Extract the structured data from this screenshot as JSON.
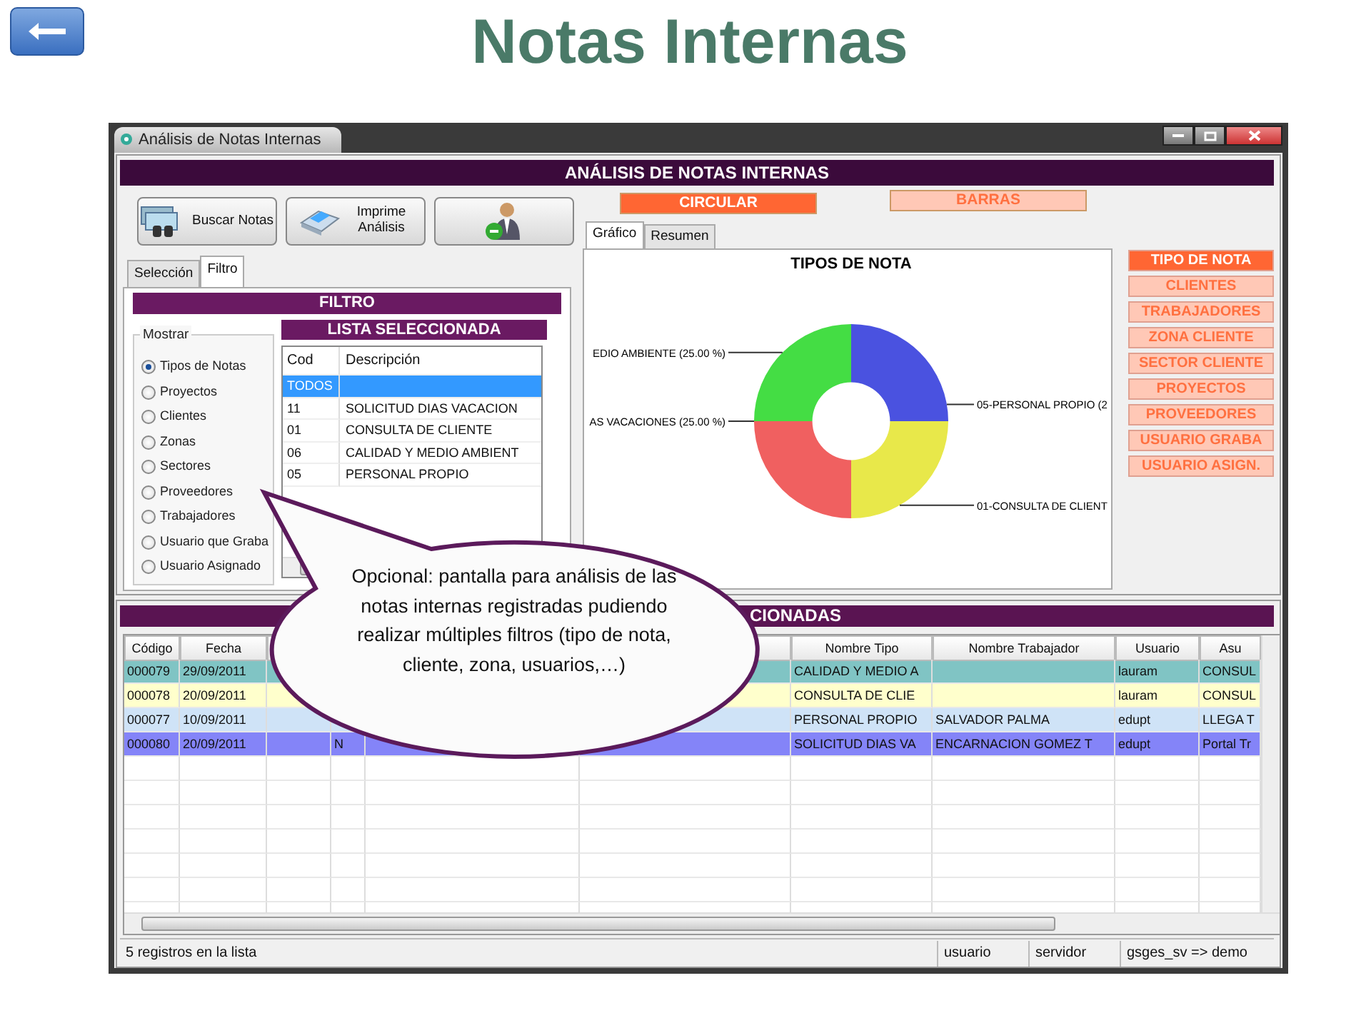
{
  "slide": {
    "title": "Notas Internas"
  },
  "window": {
    "title": "Análisis de Notas Internas",
    "header": "ANÁLISIS DE NOTAS INTERNAS"
  },
  "toolbar": [
    {
      "kind": "search",
      "label": "Buscar Notas"
    },
    {
      "kind": "print",
      "label": "Imprime Análisis"
    },
    {
      "kind": "user"
    }
  ],
  "left_tabs": [
    {
      "label": "Selección",
      "selected": false
    },
    {
      "label": "Filtro",
      "selected": true
    }
  ],
  "filter": {
    "title": "FILTRO",
    "group_label": "Mostrar",
    "list_title": "LISTA SELECCIONADA",
    "options": [
      {
        "label": "Tipos de Notas",
        "selected": true
      },
      {
        "label": "Proyectos",
        "selected": false
      },
      {
        "label": "Clientes",
        "selected": false
      },
      {
        "label": "Zonas",
        "selected": false
      },
      {
        "label": "Sectores",
        "selected": false
      },
      {
        "label": "Proveedores",
        "selected": false
      },
      {
        "label": "Trabajadores",
        "selected": false
      },
      {
        "label": "Usuario que Graba",
        "selected": false
      },
      {
        "label": "Usuario Asignado",
        "selected": false
      }
    ],
    "list_columns": [
      "Cod",
      "Descripción"
    ],
    "list_rows": [
      {
        "cells": [
          "TODOS"
        ],
        "selected": true
      },
      {
        "cells": [
          "11",
          "SOLICITUD DIAS VACACION"
        ],
        "selected": false
      },
      {
        "cells": [
          "01",
          "CONSULTA DE CLIENTE"
        ],
        "selected": false
      },
      {
        "cells": [
          "06",
          "CALIDAD Y MEDIO AMBIENT"
        ],
        "selected": false
      },
      {
        "cells": [
          "05",
          "PERSONAL PROPIO"
        ],
        "selected": false
      }
    ]
  },
  "chart_types": [
    {
      "label": "CIRCULAR",
      "selected": true
    },
    {
      "label": "BARRAS",
      "selected": false
    }
  ],
  "chart_tabs": [
    {
      "label": "Gráfico",
      "selected": true
    },
    {
      "label": "Resumen",
      "selected": false
    }
  ],
  "chart": {
    "chart_data": {
      "type": "donut",
      "title": "TIPOS DE NOTA",
      "categories": [
        "05-PERSONAL PROPIO (2",
        "01-CONSULTA DE CLIENT",
        "AS VACACIONES (25.00 %)",
        "EDIO AMBIENTE (25.00 %)"
      ],
      "values": [
        25,
        25,
        25,
        25
      ]
    }
  },
  "groupings": [
    {
      "label": "TIPO DE NOTA",
      "selected": true
    },
    {
      "label": "CLIENTES",
      "selected": false
    },
    {
      "label": "TRABAJADORES",
      "selected": false
    },
    {
      "label": "ZONA CLIENTE",
      "selected": false
    },
    {
      "label": "SECTOR CLIENTE",
      "selected": false
    },
    {
      "label": "PROYECTOS",
      "selected": false
    },
    {
      "label": "PROVEEDORES",
      "selected": false
    },
    {
      "label": "USUARIO GRABA",
      "selected": false
    },
    {
      "label": "USUARIO ASIGN.",
      "selected": false
    }
  ],
  "results": {
    "title": "CIONADAS",
    "columns": [
      "Código",
      "Fecha",
      null,
      null,
      null,
      null,
      "Nombre Tipo",
      "Nombre Trabajador",
      "Usuario",
      "Asu"
    ],
    "rows": [
      {
        "color": "#80c4c4",
        "cells": [
          "000079",
          "29/09/2011",
          null,
          null,
          null,
          null,
          "CALIDAD Y MEDIO A",
          null,
          "lauram",
          "CONSUL"
        ]
      },
      {
        "color": "#ffffcc",
        "cells": [
          "000078",
          "20/09/2011",
          null,
          null,
          null,
          null,
          "CONSULTA DE CLIE",
          null,
          "lauram",
          "CONSUL"
        ]
      },
      {
        "color": "#cfe3f7",
        "cells": [
          "000077",
          "10/09/2011",
          null,
          null,
          null,
          null,
          "PERSONAL PROPIO",
          "SALVADOR PALMA",
          "edupt",
          "LLEGA T"
        ]
      },
      {
        "color": "#8484f8",
        "cells": [
          "000080",
          "20/09/2011",
          null,
          "N",
          null,
          null,
          "SOLICITUD DIAS VA",
          "ENCARNACION GOMEZ T",
          "edupt",
          "Portal Tr"
        ]
      }
    ]
  },
  "callout": "Opcional: pantalla para análisis de las notas internas registradas pudiendo realizar múltiples filtros (tipo de nota, cliente, zona, usuarios,…)",
  "status_bar": [
    "5 registros en la lista",
    "usuario",
    "servidor",
    "gsges_sv => demo"
  ]
}
